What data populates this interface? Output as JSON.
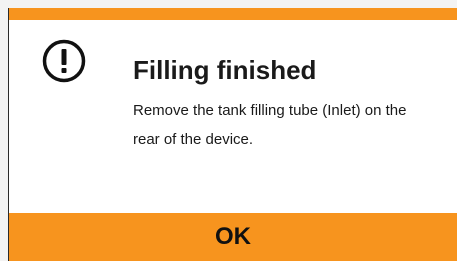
{
  "colors": {
    "accent": "#f7941e",
    "text": "#1a1a1a"
  },
  "dialog": {
    "icon": "exclamation-circle-icon",
    "title": "Filling finished",
    "message": "Remove the tank filling tube (Inlet) on the rear of the device.",
    "ok_label": "OK"
  }
}
